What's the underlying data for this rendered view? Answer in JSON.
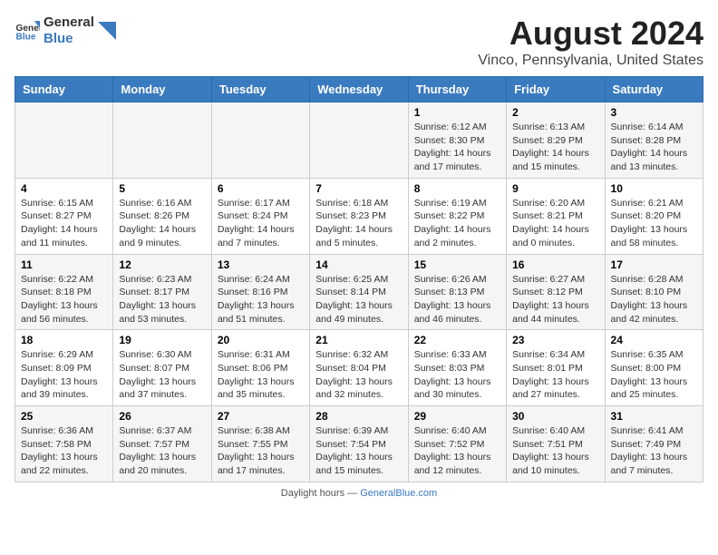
{
  "header": {
    "logo_line1": "General",
    "logo_line2": "Blue",
    "title": "August 2024",
    "subtitle": "Vinco, Pennsylvania, United States"
  },
  "days_of_week": [
    "Sunday",
    "Monday",
    "Tuesday",
    "Wednesday",
    "Thursday",
    "Friday",
    "Saturday"
  ],
  "weeks": [
    [
      {
        "day": "",
        "info": ""
      },
      {
        "day": "",
        "info": ""
      },
      {
        "day": "",
        "info": ""
      },
      {
        "day": "",
        "info": ""
      },
      {
        "day": "1",
        "info": "Sunrise: 6:12 AM\nSunset: 8:30 PM\nDaylight: 14 hours and 17 minutes."
      },
      {
        "day": "2",
        "info": "Sunrise: 6:13 AM\nSunset: 8:29 PM\nDaylight: 14 hours and 15 minutes."
      },
      {
        "day": "3",
        "info": "Sunrise: 6:14 AM\nSunset: 8:28 PM\nDaylight: 14 hours and 13 minutes."
      }
    ],
    [
      {
        "day": "4",
        "info": "Sunrise: 6:15 AM\nSunset: 8:27 PM\nDaylight: 14 hours and 11 minutes."
      },
      {
        "day": "5",
        "info": "Sunrise: 6:16 AM\nSunset: 8:26 PM\nDaylight: 14 hours and 9 minutes."
      },
      {
        "day": "6",
        "info": "Sunrise: 6:17 AM\nSunset: 8:24 PM\nDaylight: 14 hours and 7 minutes."
      },
      {
        "day": "7",
        "info": "Sunrise: 6:18 AM\nSunset: 8:23 PM\nDaylight: 14 hours and 5 minutes."
      },
      {
        "day": "8",
        "info": "Sunrise: 6:19 AM\nSunset: 8:22 PM\nDaylight: 14 hours and 2 minutes."
      },
      {
        "day": "9",
        "info": "Sunrise: 6:20 AM\nSunset: 8:21 PM\nDaylight: 14 hours and 0 minutes."
      },
      {
        "day": "10",
        "info": "Sunrise: 6:21 AM\nSunset: 8:20 PM\nDaylight: 13 hours and 58 minutes."
      }
    ],
    [
      {
        "day": "11",
        "info": "Sunrise: 6:22 AM\nSunset: 8:18 PM\nDaylight: 13 hours and 56 minutes."
      },
      {
        "day": "12",
        "info": "Sunrise: 6:23 AM\nSunset: 8:17 PM\nDaylight: 13 hours and 53 minutes."
      },
      {
        "day": "13",
        "info": "Sunrise: 6:24 AM\nSunset: 8:16 PM\nDaylight: 13 hours and 51 minutes."
      },
      {
        "day": "14",
        "info": "Sunrise: 6:25 AM\nSunset: 8:14 PM\nDaylight: 13 hours and 49 minutes."
      },
      {
        "day": "15",
        "info": "Sunrise: 6:26 AM\nSunset: 8:13 PM\nDaylight: 13 hours and 46 minutes."
      },
      {
        "day": "16",
        "info": "Sunrise: 6:27 AM\nSunset: 8:12 PM\nDaylight: 13 hours and 44 minutes."
      },
      {
        "day": "17",
        "info": "Sunrise: 6:28 AM\nSunset: 8:10 PM\nDaylight: 13 hours and 42 minutes."
      }
    ],
    [
      {
        "day": "18",
        "info": "Sunrise: 6:29 AM\nSunset: 8:09 PM\nDaylight: 13 hours and 39 minutes."
      },
      {
        "day": "19",
        "info": "Sunrise: 6:30 AM\nSunset: 8:07 PM\nDaylight: 13 hours and 37 minutes."
      },
      {
        "day": "20",
        "info": "Sunrise: 6:31 AM\nSunset: 8:06 PM\nDaylight: 13 hours and 35 minutes."
      },
      {
        "day": "21",
        "info": "Sunrise: 6:32 AM\nSunset: 8:04 PM\nDaylight: 13 hours and 32 minutes."
      },
      {
        "day": "22",
        "info": "Sunrise: 6:33 AM\nSunset: 8:03 PM\nDaylight: 13 hours and 30 minutes."
      },
      {
        "day": "23",
        "info": "Sunrise: 6:34 AM\nSunset: 8:01 PM\nDaylight: 13 hours and 27 minutes."
      },
      {
        "day": "24",
        "info": "Sunrise: 6:35 AM\nSunset: 8:00 PM\nDaylight: 13 hours and 25 minutes."
      }
    ],
    [
      {
        "day": "25",
        "info": "Sunrise: 6:36 AM\nSunset: 7:58 PM\nDaylight: 13 hours and 22 minutes."
      },
      {
        "day": "26",
        "info": "Sunrise: 6:37 AM\nSunset: 7:57 PM\nDaylight: 13 hours and 20 minutes."
      },
      {
        "day": "27",
        "info": "Sunrise: 6:38 AM\nSunset: 7:55 PM\nDaylight: 13 hours and 17 minutes."
      },
      {
        "day": "28",
        "info": "Sunrise: 6:39 AM\nSunset: 7:54 PM\nDaylight: 13 hours and 15 minutes."
      },
      {
        "day": "29",
        "info": "Sunrise: 6:40 AM\nSunset: 7:52 PM\nDaylight: 13 hours and 12 minutes."
      },
      {
        "day": "30",
        "info": "Sunrise: 6:40 AM\nSunset: 7:51 PM\nDaylight: 13 hours and 10 minutes."
      },
      {
        "day": "31",
        "info": "Sunrise: 6:41 AM\nSunset: 7:49 PM\nDaylight: 13 hours and 7 minutes."
      }
    ]
  ],
  "footer": {
    "text": "Daylight hours",
    "url_label": "GeneralBlue.com"
  }
}
